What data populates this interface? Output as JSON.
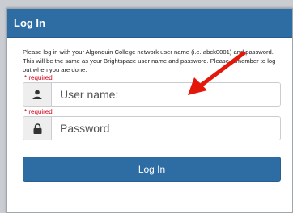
{
  "panel": {
    "title": "Log In",
    "instructions": "Please log in with your Algonquin College network user name (i.e. abck0001) and password. This will be the same as your Brightspace user name and password. Please remember to log out when you are done.",
    "required_text": "* required"
  },
  "form": {
    "username_placeholder": "User name:",
    "password_placeholder": "Password",
    "submit_label": "Log In"
  },
  "icons": {
    "username": "user-icon",
    "password": "lock-icon",
    "annotation": "red-arrow-icon"
  },
  "colors": {
    "header_bg": "#2e6da4",
    "button_bg": "#2e6da4",
    "required": "#d0021b",
    "annotation_arrow": "#e3170a"
  }
}
